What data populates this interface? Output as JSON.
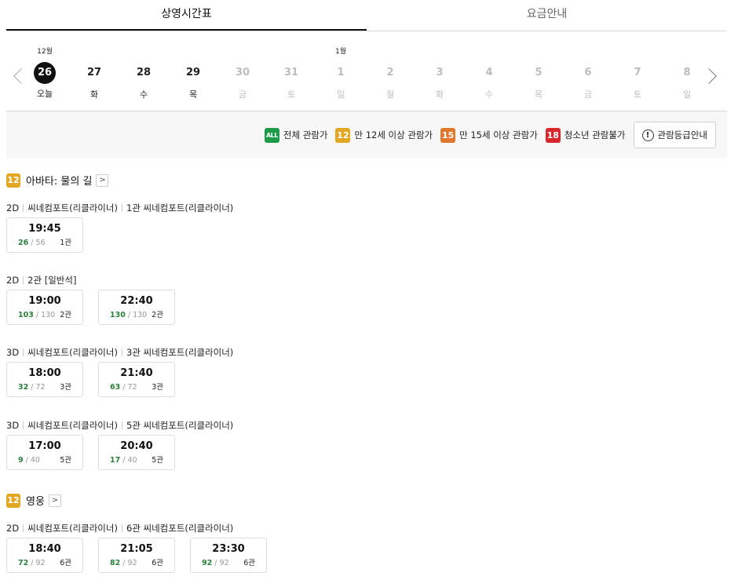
{
  "tabs": [
    {
      "label": "상영시간표",
      "active": true
    },
    {
      "label": "요금안내",
      "active": false
    }
  ],
  "dates": [
    {
      "month": "12월",
      "day": "26",
      "weekday": "오늘",
      "today": true,
      "dim": false
    },
    {
      "month": "",
      "day": "27",
      "weekday": "화",
      "today": false,
      "dim": false
    },
    {
      "month": "",
      "day": "28",
      "weekday": "수",
      "today": false,
      "dim": false
    },
    {
      "month": "",
      "day": "29",
      "weekday": "목",
      "today": false,
      "dim": false
    },
    {
      "month": "",
      "day": "30",
      "weekday": "금",
      "today": false,
      "dim": true
    },
    {
      "month": "",
      "day": "31",
      "weekday": "토",
      "today": false,
      "dim": true
    },
    {
      "month": "1월",
      "day": "1",
      "weekday": "일",
      "today": false,
      "dim": true
    },
    {
      "month": "",
      "day": "2",
      "weekday": "월",
      "today": false,
      "dim": true
    },
    {
      "month": "",
      "day": "3",
      "weekday": "화",
      "today": false,
      "dim": true
    },
    {
      "month": "",
      "day": "4",
      "weekday": "수",
      "today": false,
      "dim": true
    },
    {
      "month": "",
      "day": "5",
      "weekday": "목",
      "today": false,
      "dim": true
    },
    {
      "month": "",
      "day": "6",
      "weekday": "금",
      "today": false,
      "dim": true
    },
    {
      "month": "",
      "day": "7",
      "weekday": "토",
      "today": false,
      "dim": true
    },
    {
      "month": "",
      "day": "8",
      "weekday": "일",
      "today": false,
      "dim": true
    }
  ],
  "legend": {
    "items": [
      {
        "badge": "ALL",
        "cls": "all",
        "label": "전체 관람가",
        "color": "#1e9b48"
      },
      {
        "badge": "12",
        "cls": "r12",
        "label": "만 12세 이상 관람가",
        "color": "#e2a823"
      },
      {
        "badge": "15",
        "cls": "r15",
        "label": "만 15세 이상 관람가",
        "color": "#e0772e"
      },
      {
        "badge": "18",
        "cls": "r18",
        "label": "청소년 관람불가",
        "color": "#d7262e"
      }
    ],
    "guide_button": "관람등급안내",
    "guide_icon": "!"
  },
  "movies": [
    {
      "rating": "12",
      "title": "아바타: 물의 길",
      "link_icon": ">",
      "screens": [
        {
          "format": "2D",
          "name": "씨네컴포트(리클라이너)",
          "hall": "1관 씨네컴포트(리클라이너)",
          "slots": [
            {
              "time": "19:45",
              "avail": "26",
              "total": "/ 56",
              "hall": "1관"
            }
          ]
        },
        {
          "format": "2D",
          "name": "",
          "hall": "2관 [일반석]",
          "slots": [
            {
              "time": "19:00",
              "avail": "103",
              "total": "/ 130",
              "hall": "2관"
            },
            {
              "time": "22:40",
              "avail": "130",
              "total": "/ 130",
              "hall": "2관"
            }
          ]
        },
        {
          "format": "3D",
          "name": "씨네컴포트(리클라이너)",
          "hall": "3관 씨네컴포트(리클라이너)",
          "slots": [
            {
              "time": "18:00",
              "avail": "32",
              "total": "/ 72",
              "hall": "3관"
            },
            {
              "time": "21:40",
              "avail": "63",
              "total": "/ 72",
              "hall": "3관"
            }
          ]
        },
        {
          "format": "3D",
          "name": "씨네컴포트(리클라이너)",
          "hall": "5관 씨네컴포트(리클라이너)",
          "slots": [
            {
              "time": "17:00",
              "avail": "9",
              "total": "/ 40",
              "hall": "5관"
            },
            {
              "time": "20:40",
              "avail": "17",
              "total": "/ 40",
              "hall": "5관"
            }
          ]
        }
      ]
    },
    {
      "rating": "12",
      "title": "영웅",
      "link_icon": ">",
      "screens": [
        {
          "format": "2D",
          "name": "씨네컴포트(리클라이너)",
          "hall": "6관 씨네컴포트(리클라이너)",
          "slots": [
            {
              "time": "18:40",
              "avail": "72",
              "total": "/ 92",
              "hall": "6관"
            },
            {
              "time": "21:05",
              "avail": "82",
              "total": "/ 92",
              "hall": "6관"
            },
            {
              "time": "23:30",
              "avail": "92",
              "total": "/ 92",
              "hall": "6관"
            }
          ]
        }
      ]
    }
  ]
}
